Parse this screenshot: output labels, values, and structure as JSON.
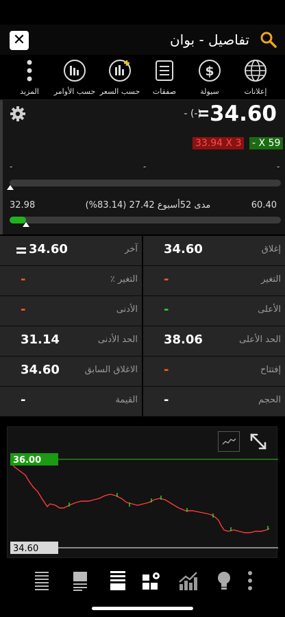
{
  "header": {
    "title": "تفاصيل - بوان",
    "close_icon": "close-icon",
    "search_icon": "search-icon"
  },
  "toolbar": [
    {
      "label": "إعلانات",
      "icon": "globe-icon"
    },
    {
      "label": "سيولة",
      "icon": "dollar-icon"
    },
    {
      "label": "صفقات",
      "icon": "document-icon"
    },
    {
      "label": "حسب السعر",
      "icon": "chart-add-icon"
    },
    {
      "label": "حسب الأوامر",
      "icon": "bar-chart-icon"
    },
    {
      "label": "المزيد",
      "icon": "more-vertical-icon"
    }
  ],
  "quote": {
    "price": "34.60",
    "change": "- (-)",
    "ask": "33.94 X 3",
    "bid": "- X 59",
    "range_low_label": "-",
    "range_mid_label": "-",
    "range_high_label": "-",
    "week52_low": "32.98",
    "week52_high": "60.40",
    "week52_text": "مدى 52أسبوع 27.42 (83.14%)",
    "week52_position": 0.06
  },
  "stats": [
    {
      "right": {
        "label": "إغلاق",
        "value": "34.60",
        "style": "white"
      },
      "left": {
        "label": "آخر",
        "value": "34.60",
        "style": "white"
      }
    },
    {
      "right": {
        "label": "التغير",
        "value": "-",
        "style": "red"
      },
      "left": {
        "label": "التغير ٪",
        "value": "-",
        "style": "red"
      }
    },
    {
      "right": {
        "label": "الأعلى",
        "value": "-",
        "style": "green"
      },
      "left": {
        "label": "الأدنى",
        "value": "-",
        "style": "red"
      }
    },
    {
      "right": {
        "label": "الحد الأعلى",
        "value": "38.06",
        "style": "white"
      },
      "left": {
        "label": "الحد الأدنى",
        "value": "31.14",
        "style": "white"
      }
    },
    {
      "right": {
        "label": "إفتتاح",
        "value": "-",
        "style": "red"
      },
      "left": {
        "label": "الاغلاق السابق",
        "value": "34.60",
        "style": "white"
      }
    },
    {
      "right": {
        "label": "الحجم",
        "value": "-",
        "style": "white"
      },
      "left": {
        "label": "القيمة",
        "value": "-",
        "style": "white"
      }
    }
  ],
  "chart": {
    "upper_label": "36.00",
    "lower_label": "34.60",
    "colors": {
      "line": "#ff3b3b",
      "up": "#2bd22b",
      "upper": "#1fa01f",
      "lower": "#cfcfcf"
    }
  },
  "bottom_icons": [
    "list-icon",
    "list-alt-icon",
    "list-bold-icon",
    "settings-grid-icon",
    "chart-trend-icon",
    "lightbulb-icon",
    "more-vertical-icon"
  ]
}
